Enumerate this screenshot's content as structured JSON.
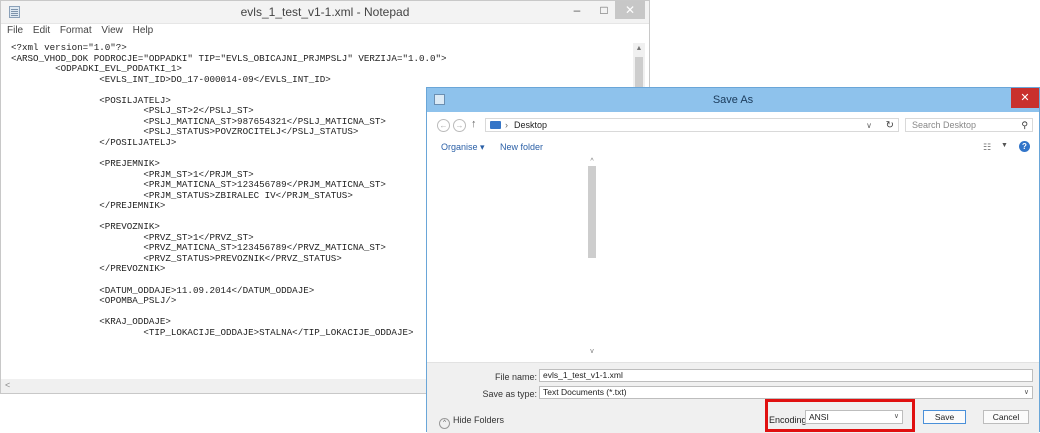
{
  "notepad": {
    "title": "evls_1_test_v1-1.xml - Notepad",
    "menu": [
      "File",
      "Edit",
      "Format",
      "View",
      "Help"
    ],
    "controls": {
      "minimize": "–",
      "maximize": "□",
      "close": "✕"
    },
    "lines": [
      "<?xml version=\"1.0\"?>",
      "<ARSO_VHOD_DOK PODROCJE=\"ODPADKI\" TIP=\"EVLS_OBICAJNI_PRJMPSLJ\" VERZIJA=\"1.0.0\">",
      "        <ODPADKI_EVL_PODATKI_1>",
      "                <EVLS_INT_ID>DO_17-000014-09</EVLS_INT_ID>",
      "",
      "                <POSILJATELJ>",
      "                        <PSLJ_ST>2</PSLJ_ST>",
      "                        <PSLJ_MATICNA_ST>987654321</PSLJ_MATICNA_ST>",
      "                        <PSLJ_STATUS>POVZROCITELJ</PSLJ_STATUS>",
      "                </POSILJATELJ>",
      "",
      "                <PREJEMNIK>",
      "                        <PRJM_ST>1</PRJM_ST>",
      "                        <PRJM_MATICNA_ST>123456789</PRJM_MATICNA_ST>",
      "                        <PRJM_STATUS>ZBIRALEC IV</PRJM_STATUS>",
      "                </PREJEMNIK>",
      "",
      "                <PREVOZNIK>",
      "                        <PRVZ_ST>1</PRVZ_ST>",
      "                        <PRVZ_MATICNA_ST>123456789</PRVZ_MATICNA_ST>",
      "                        <PRVZ_STATUS>PREVOZNIK</PRVZ_STATUS>",
      "                </PREVOZNIK>",
      "",
      "                <DATUM_ODDAJE>11.09.2014</DATUM_ODDAJE>",
      "                <OPOMBA_PSLJ/>",
      "",
      "                <KRAJ_ODDAJE>",
      "                        <TIP_LOKACIJE_ODDAJE>STALNA</TIP_LOKACIJE_ODDAJE>"
    ]
  },
  "dialog": {
    "title": "Save As",
    "close_glyph": "✕",
    "address": {
      "location": "Desktop"
    },
    "search": {
      "placeholder": "Search Desktop"
    },
    "toolbar": {
      "organise": "Organise ▾",
      "new_folder": "New folder"
    },
    "file_name": {
      "label": "File name:",
      "value": "evls_1_test_v1-1.xml"
    },
    "save_as_type": {
      "label": "Save as type:",
      "value": "Text Documents (*.txt)"
    },
    "hide_folders": "Hide Folders",
    "encoding": {
      "label": "Encoding:",
      "value": "ANSI"
    },
    "save_label": "Save",
    "cancel_label": "Cancel"
  },
  "colors": {
    "dialog_title_bar": "#8ec2ec",
    "dialog_close": "#c9302c",
    "highlight_box": "#e01010",
    "link_text": "#2a5fa6"
  }
}
